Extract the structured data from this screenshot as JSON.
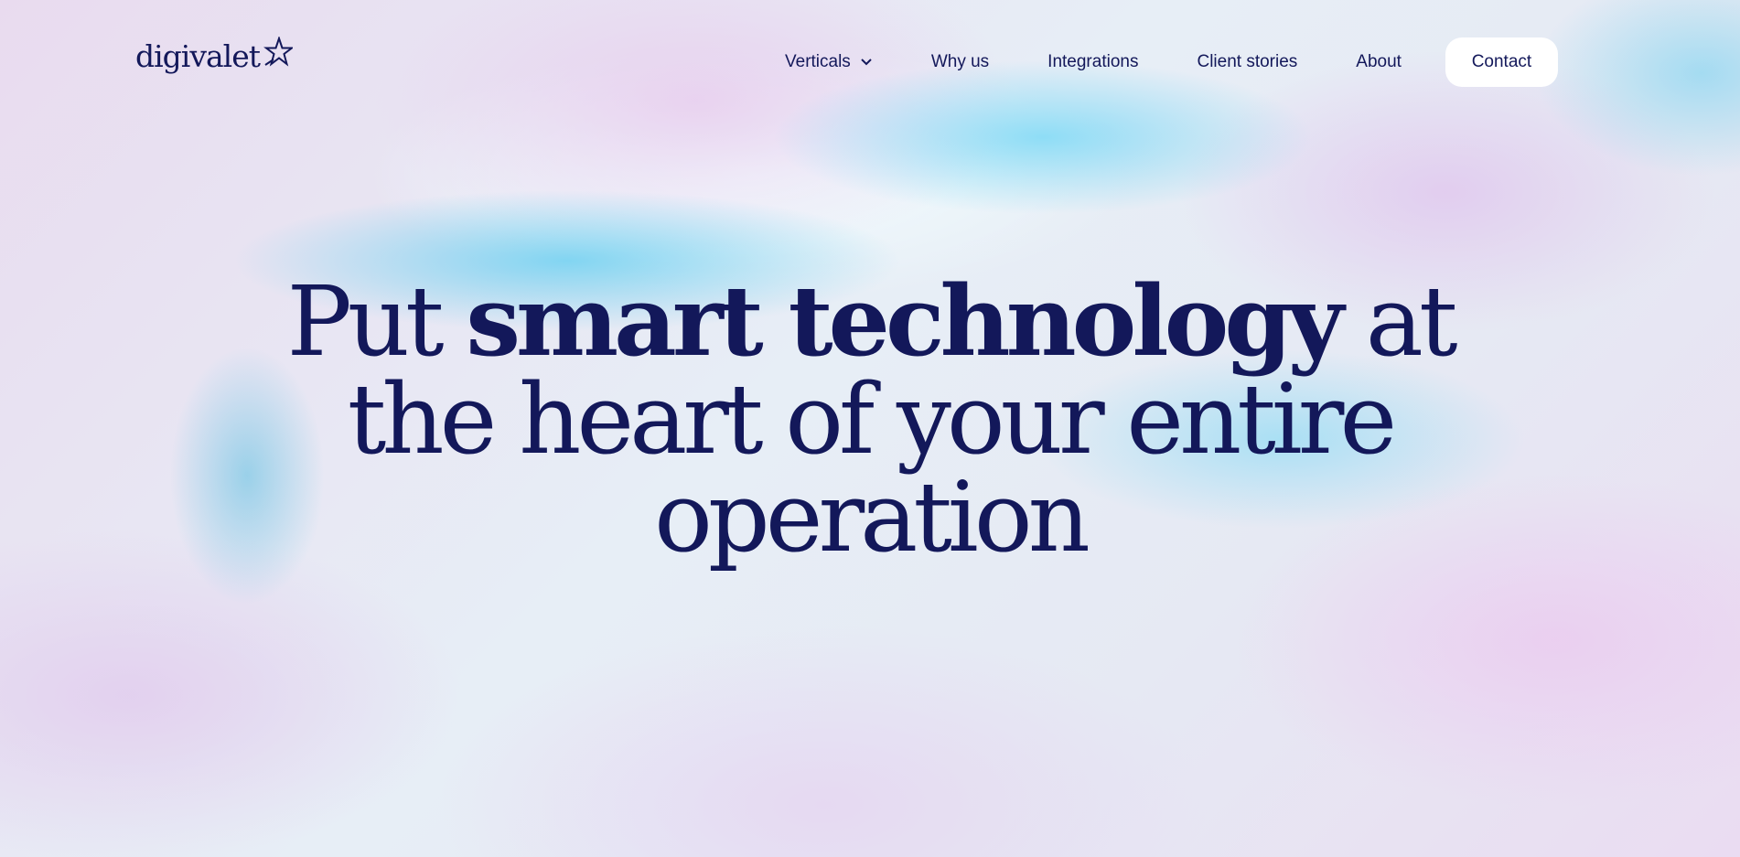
{
  "header": {
    "logo_text": "digivalet",
    "logo_icon": "star-icon"
  },
  "nav": {
    "items": [
      {
        "label": "Verticals",
        "has_dropdown": true
      },
      {
        "label": "Why us"
      },
      {
        "label": "Integrations"
      },
      {
        "label": "Client stories"
      },
      {
        "label": "About"
      }
    ],
    "contact_label": "Contact"
  },
  "hero": {
    "part1": "Put ",
    "bold": "smart technology",
    "part2": " at",
    "line2": "the heart of your entire",
    "line3": "operation"
  },
  "colors": {
    "text": "#13185a",
    "button_bg": "#ffffff"
  }
}
